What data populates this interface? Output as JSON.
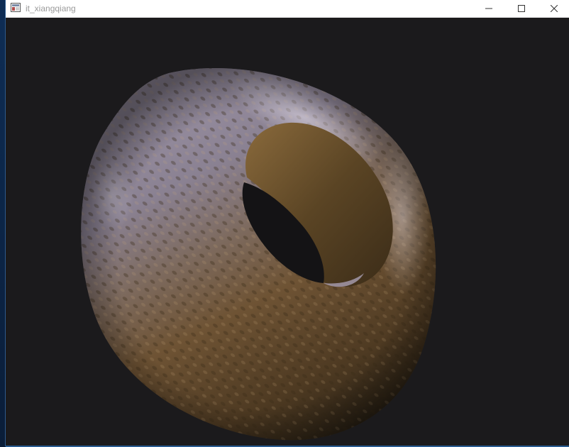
{
  "window": {
    "title": "it_xiangqiang",
    "icon": "app-window-icon",
    "controls": {
      "minimize": "minimize-icon",
      "maximize": "maximize-icon",
      "close": "close-icon"
    }
  },
  "scene": {
    "object": "textured-torus",
    "background_color": "#1b1a1c",
    "top_color": "#8e8496",
    "bottom_color": "#6e5230"
  }
}
